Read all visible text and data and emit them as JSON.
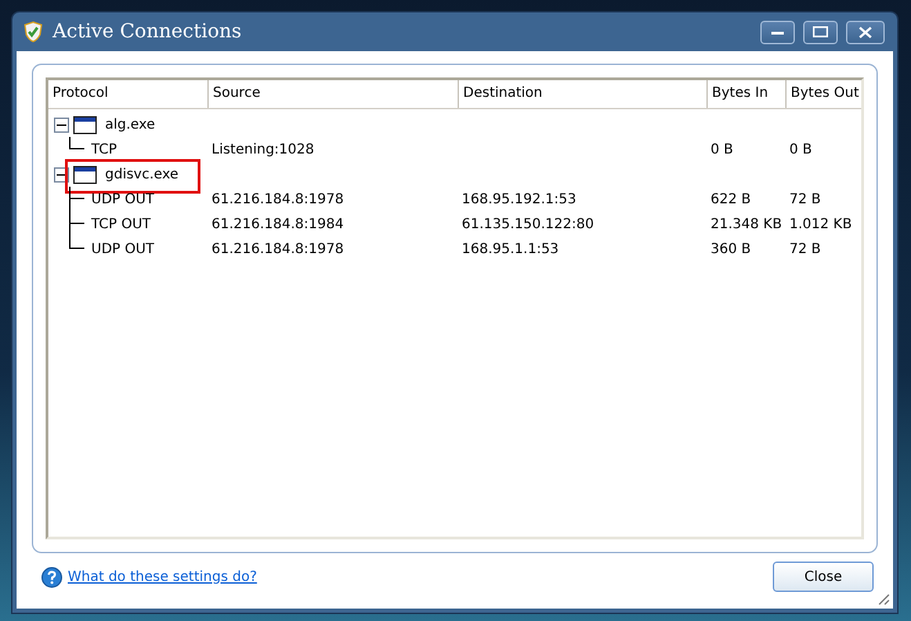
{
  "window": {
    "title": "Active Connections"
  },
  "table": {
    "columns": [
      "Protocol",
      "Source",
      "Destination",
      "Bytes In",
      "Bytes Out"
    ],
    "rows": [
      {
        "name": "alg.exe",
        "expanded": true,
        "highlighted": false,
        "children": [
          {
            "protocol": "TCP",
            "source": "Listening:1028",
            "bytes_in": "0 B",
            "bytes_out": "0 B"
          }
        ]
      },
      {
        "name": "gdisvc.exe",
        "expanded": true,
        "highlighted": true,
        "children": [
          {
            "protocol": "UDP OUT",
            "source": "61.216.184.8:1978",
            "destination": "168.95.192.1:53",
            "bytes_in": "622 B",
            "bytes_out": "72 B"
          },
          {
            "protocol": "TCP OUT",
            "source": "61.216.184.8:1984",
            "destination": "61.135.150.122:80",
            "bytes_in": "21.348 KB",
            "bytes_out": "1.012 KB"
          },
          {
            "protocol": "UDP OUT",
            "source": "61.216.184.8:1978",
            "destination": "168.95.1.1:53",
            "bytes_in": "360 B",
            "bytes_out": "72 B"
          }
        ]
      }
    ]
  },
  "help_link": "What do these settings do?",
  "close_button": "Close"
}
